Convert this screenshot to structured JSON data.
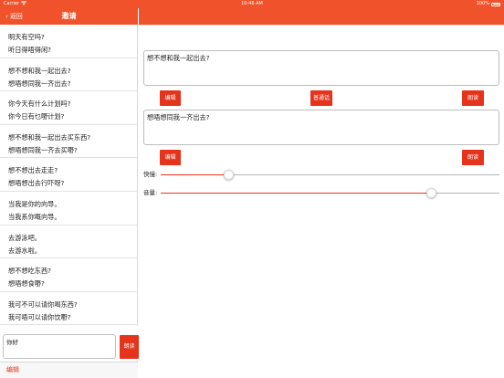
{
  "status_bar": {
    "carrier": "Carrier",
    "wifi_icon": "wifi-icon",
    "time": "10:46 AM",
    "battery_text": "100%"
  },
  "sidebar": {
    "back_label": "返回",
    "title": "邀请",
    "items": [
      {
        "line1": "明天有空吗?",
        "line2": "听日得唔得闲?"
      },
      {
        "line1": "想不想和我一起出去?",
        "line2": "想唔想同我一齐出去?"
      },
      {
        "line1": "你今天有什么计划吗?",
        "line2": "你今日有乜嘢计划?"
      },
      {
        "line1": "想不想和我一起出去买东西?",
        "line2": "想唔想同我一齐去买嘢?"
      },
      {
        "line1": "想不想出去走走?",
        "line2": "想唔想出去行吓呀?"
      },
      {
        "line1": "当我是你的向导。",
        "line2": "当我系你嘅向导。"
      },
      {
        "line1": "去游泳吧。",
        "line2": "去游水啦。"
      },
      {
        "line1": "想不想吃东西?",
        "line2": "想唔想食嘢?"
      },
      {
        "line1": "我可不可以请你喝东西?",
        "line2": "我可唔可以请你饮嘢?"
      }
    ],
    "input_value": "你好",
    "read_label": "朗读",
    "edit_label": "编辑"
  },
  "detail": {
    "mandarin_text": "想不想和我一起出去?",
    "cantonese_text": "想唔想同我一齐出去?",
    "edit_label": "编辑",
    "mandarin_label": "普通话",
    "read_label": "朗读",
    "speed_label": "快慢:",
    "volume_label": "音量:",
    "speed_value": 0.2,
    "volume_value": 0.8
  },
  "colors": {
    "accent": "#f0532b",
    "button": "#e6341c",
    "track_min": "#e6341c",
    "track_max": "#b5b5b5"
  }
}
